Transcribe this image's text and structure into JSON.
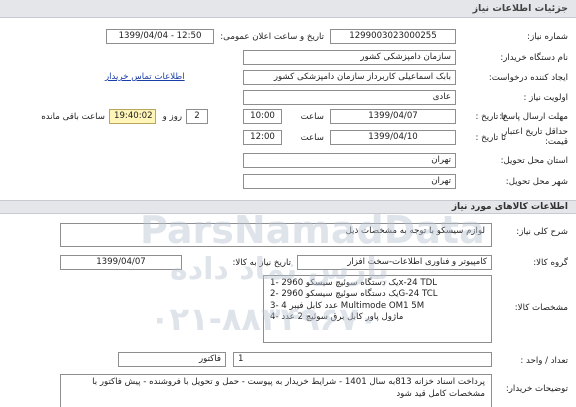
{
  "page_title": "جزئیات اطلاعات نیاز",
  "need_number": {
    "label": "شماره نیاز:",
    "value": "1299003023000255"
  },
  "announce_datetime": {
    "label": "تاریخ و ساعت اعلان عمومی:",
    "value": "1399/04/04 - 12:50"
  },
  "buyer_org": {
    "label": "نام دستگاه خریدار:",
    "value": "سازمان دامپزشکی کشور"
  },
  "requester": {
    "label": "ایجاد کننده درخواست:",
    "value": "بابک اسماعیلی کاربرداز سازمان دامپزشکی کشور"
  },
  "contact_link": "اطلاعات تماس خریدار",
  "priority": {
    "label": "اولویت نیاز :",
    "value": "عادی"
  },
  "deadline_send": {
    "label": "مهلت ارسال پاسخ:",
    "until_label": "تا تاریخ :",
    "date": "1399/04/07",
    "time_label": "ساعت",
    "time": "10:00",
    "days": "2",
    "days_label": "روز و",
    "remaining_time": "19:40:02",
    "remaining_label": "ساعت باقی مانده"
  },
  "price_validity": {
    "label": "حداقل تاریخ اعتبار قیمت:",
    "until_label": "تا تاریخ :",
    "date": "1399/04/10",
    "time_label": "ساعت",
    "time": "12:00"
  },
  "delivery_province": {
    "label": "استان محل تحویل:",
    "value": "تهران"
  },
  "delivery_city": {
    "label": "شهر محل تحویل:",
    "value": "تهران"
  },
  "goods_section_title": "اطلاعات کالاهای مورد نیاز",
  "general_desc": {
    "label": "شرح کلی نیاز:",
    "value": "لوازم سیسکو با توجه به مشخصات ذیل"
  },
  "goods_group": {
    "label": "گروه کالا:",
    "value": "کامپیوتر و فناوری اطلاعات-سخت افزار",
    "need_date_label": "تاریخ نیاز به کالا:",
    "need_date": "1399/04/07"
  },
  "goods_specs": {
    "label": "مشخصات کالا:",
    "lines": [
      "1- یک دستگاه سوئیچ سیسکو 2960x-24 TDL",
      "2- یک دستگاه سوئیچ سیسکو 2960G-24 TCL",
      "3- 4 عدد کابل فیبر Multimode OM1 5M",
      "4- ماژول پاور کابل برق سوئیچ 2 عدد"
    ]
  },
  "quantity": {
    "label": "تعداد / واحد :",
    "count": "1",
    "unit": "فاکتور"
  },
  "buyer_notes": {
    "label": "توضیحات خریدار:",
    "value": "پرداخت اسناد خزانه 813به سال 1401 - شرایط خریدار به پیوست - حمل و تحویل با فروشنده - پیش فاکتور با مشخصات کامل قید شود"
  },
  "watermarks": [
    "ParsNamadData",
    "پارس نماد داده",
    "۰۲۱-۸۸۳۴۹۶۷۰"
  ]
}
